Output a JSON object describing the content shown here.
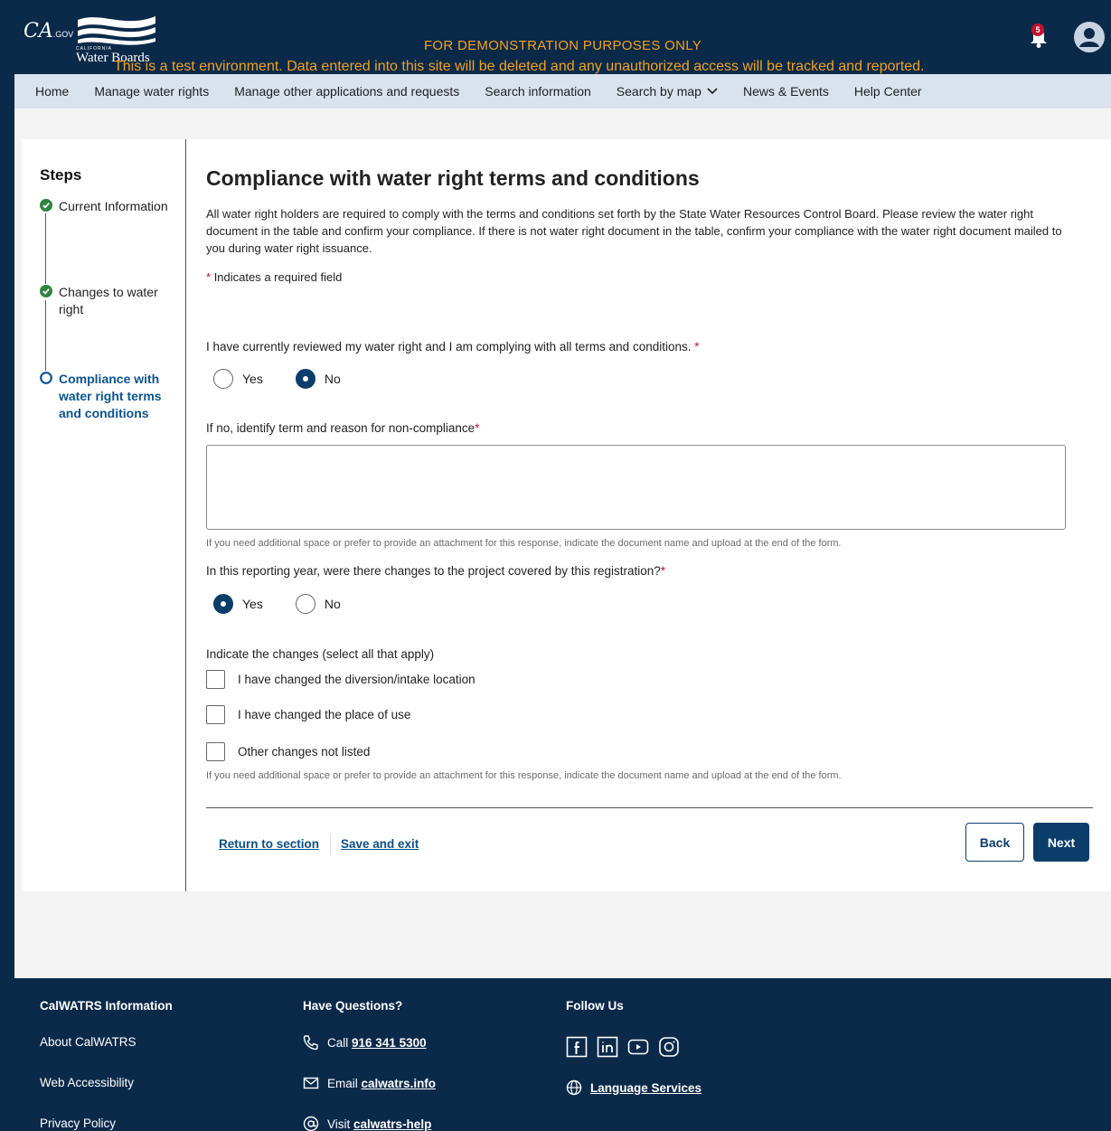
{
  "header": {
    "ca_logo": "CA",
    "ca_logo_sub": ".GOV",
    "brand_small": "CALIFORNIA",
    "brand": "Water Boards",
    "demo_banner": "FOR DEMONSTRATION PURPOSES ONLY",
    "test_banner": "This is a test environment. Data entered into this site will be deleted and any unauthorized access will be tracked and reported.",
    "notification_count": "5"
  },
  "nav": {
    "items": [
      {
        "label": "Home"
      },
      {
        "label": "Manage water rights"
      },
      {
        "label": "Manage other applications and requests"
      },
      {
        "label": "Search information"
      },
      {
        "label": "Search by map"
      },
      {
        "label": "News & Events"
      },
      {
        "label": "Help Center"
      }
    ]
  },
  "steps": {
    "title": "Steps",
    "items": [
      {
        "label": "Current Information",
        "status": "complete"
      },
      {
        "label": "Changes to water right",
        "status": "complete"
      },
      {
        "label": "Compliance with water right terms and conditions",
        "status": "current"
      }
    ]
  },
  "form": {
    "title": "Compliance with water right terms and conditions",
    "intro": "All water right holders are required to comply with the terms and conditions set forth by the State Water Resources Control Board. Please review the water right document in the table and confirm your compliance. If there is not water right document in the table, confirm your compliance with the water right document mailed to you during water right issuance.",
    "required_marker": "*",
    "required_note": "Indicates a required field",
    "q1": {
      "label": "I have currently reviewed my water right and I am complying with all terms and conditions.",
      "options": [
        "Yes",
        "No"
      ],
      "selected": "No"
    },
    "q2": {
      "label": "If no, identify term and reason for non-compliance",
      "value": ""
    },
    "hint": "If you need additional space or prefer to provide an attachment for this response, indicate the document name and upload at the end of the form.",
    "q3": {
      "label": "In this reporting year, were there changes to the project covered by this registration?",
      "options": [
        "Yes",
        "No"
      ],
      "selected": "Yes"
    },
    "q4": {
      "label": "Indicate the changes (select all that apply)",
      "options": [
        "I have changed the diversion/intake location",
        "I have changed the place of use",
        "Other changes not listed"
      ]
    },
    "actions": {
      "return": "Return to section",
      "save": "Save and exit",
      "back": "Back",
      "next": "Next"
    }
  },
  "footer": {
    "col1": {
      "heading": "CalWATRS Information",
      "items": [
        "About CalWATRS",
        "Web Accessibility",
        "Privacy Policy"
      ]
    },
    "col2": {
      "heading": "Have Questions?",
      "call_prefix": "Call",
      "call_value": "916 341 5300",
      "email_prefix": "Email",
      "email_value": "calwatrs.info",
      "visit_prefix": "Visit",
      "visit_value": "calwatrs-help"
    },
    "col3": {
      "heading": "Follow Us",
      "language": "Language Services"
    }
  },
  "colors": {
    "navy": "#0b2a4a",
    "primary": "#0b3d6b",
    "accent": "#f4a11b",
    "required": "#c8102e",
    "success": "#2e8540"
  }
}
